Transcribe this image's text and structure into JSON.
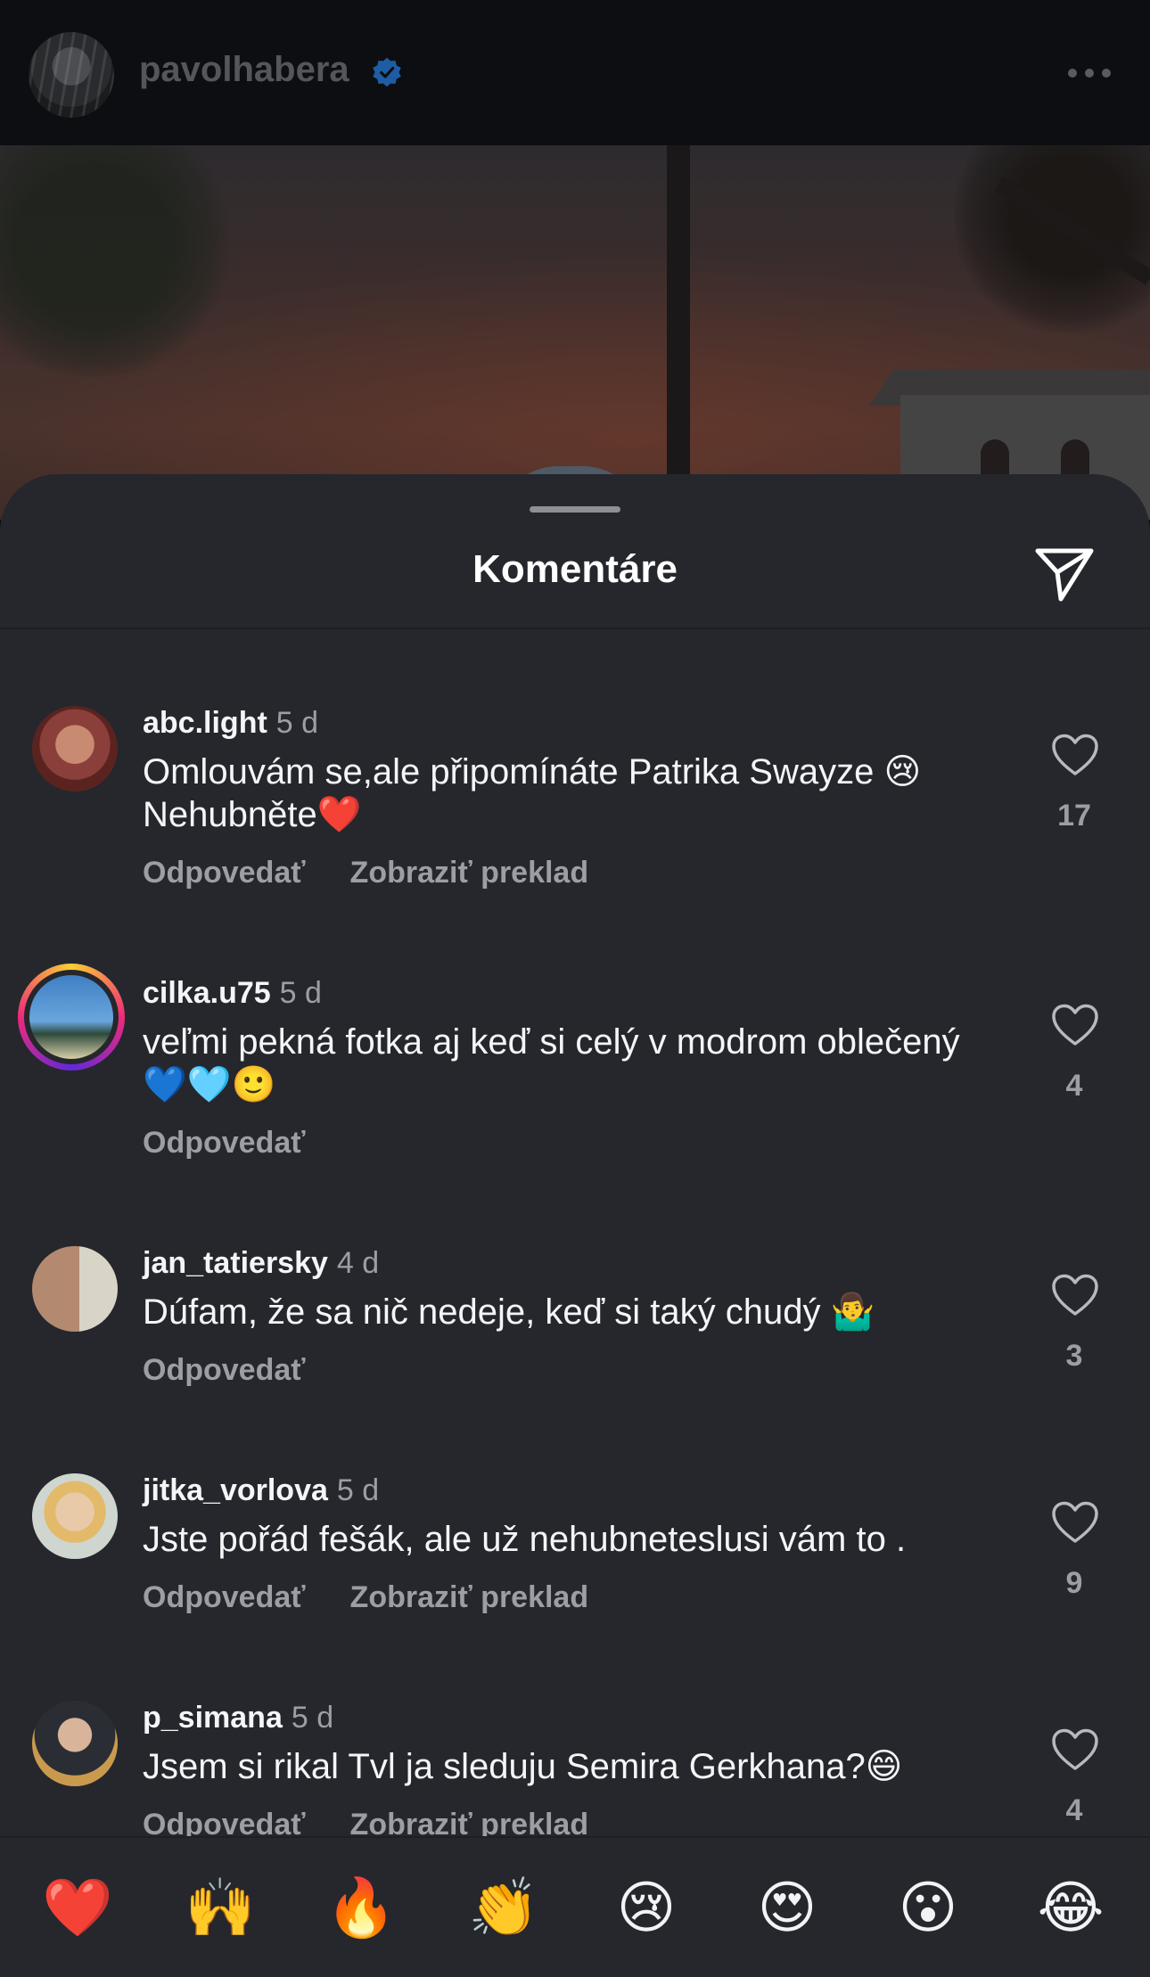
{
  "header": {
    "username": "pavolhabera",
    "verified_icon": "verified-badge-icon",
    "more_icon": "more-horizontal-icon"
  },
  "sheet": {
    "title": "Komentáre",
    "share_icon": "paper-plane-icon"
  },
  "comments": [
    {
      "username": "abc.light",
      "time": "5 d",
      "text": "Omlouvám se,ale připomínáte Patrika Swayze 😢 Nehubněte❤️",
      "likes": "17",
      "reply_label": "Odpovedať",
      "translate_label": "Zobraziť preklad"
    },
    {
      "username": "cilka.u75",
      "time": "5 d",
      "text": "veľmi pekná fotka aj keď si celý v modrom oblečený 💙🩵🙂",
      "likes": "4",
      "reply_label": "Odpovedať"
    },
    {
      "username": "jan_tatiersky",
      "time": "4 d",
      "text": "Dúfam, že sa nič nedeje, keď si taký chudý 🤷‍♂️",
      "likes": "3",
      "reply_label": "Odpovedať"
    },
    {
      "username": "jitka_vorlova",
      "time": "5 d",
      "text": "Jste pořád fešák, ale už nehubneteslusi vám to .",
      "likes": "9",
      "reply_label": "Odpovedať",
      "translate_label": "Zobraziť preklad"
    },
    {
      "username": "p_simana",
      "time": "5 d",
      "text": "Jsem si rikal Tvl ja sleduju Semira Gerkhana?😄",
      "likes": "4",
      "reply_label": "Odpovedať",
      "translate_label": "Zobraziť preklad"
    }
  ],
  "reactions": [
    "❤️",
    "🙌",
    "🔥",
    "👏",
    "😢",
    "😍",
    "😮",
    "😂"
  ],
  "colors": {
    "sheet_bg": "#25272c",
    "secondary_text": "#9b9ea4",
    "verified": "#2a8cf0"
  }
}
